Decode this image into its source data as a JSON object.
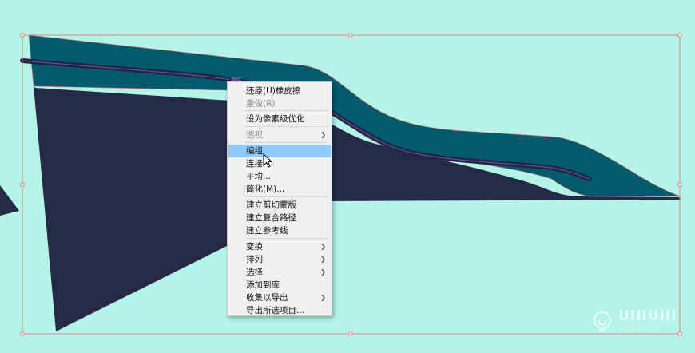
{
  "canvas": {
    "background": "#b3f4e6",
    "dark_shape_color": "#262a48",
    "teal_shape_color": "#025a6c",
    "selection_color": "#e06060",
    "guide_line_color": "#22254a"
  },
  "path_tag": "路径",
  "context_menu": {
    "items": [
      {
        "label": "还原(U)橡皮擦",
        "enabled": true
      },
      {
        "label": "重做(R)",
        "enabled": false
      },
      {
        "label": "设为像素级优化",
        "enabled": true
      },
      {
        "label": "透视",
        "enabled": false,
        "submenu": true
      },
      {
        "label": "编组",
        "enabled": true,
        "highlighted": true
      },
      {
        "label": "连接",
        "enabled": true
      },
      {
        "label": "平均...",
        "enabled": true
      },
      {
        "label": "简化(M)...",
        "enabled": true
      },
      {
        "label": "建立剪切蒙版",
        "enabled": true
      },
      {
        "label": "建立复合路径",
        "enabled": true
      },
      {
        "label": "建立参考线",
        "enabled": true
      },
      {
        "label": "变换",
        "enabled": true,
        "submenu": true
      },
      {
        "label": "排列",
        "enabled": true,
        "submenu": true
      },
      {
        "label": "选择",
        "enabled": true,
        "submenu": true
      },
      {
        "label": "添加到库",
        "enabled": true
      },
      {
        "label": "收集以导出",
        "enabled": true,
        "submenu": true
      },
      {
        "label": "导出所选项目...",
        "enabled": true
      }
    ],
    "highlight_color": "#91c9f7"
  },
  "watermark": {
    "text": "UIIIUIII",
    "subtitle": "优设 优秀网页设计"
  }
}
